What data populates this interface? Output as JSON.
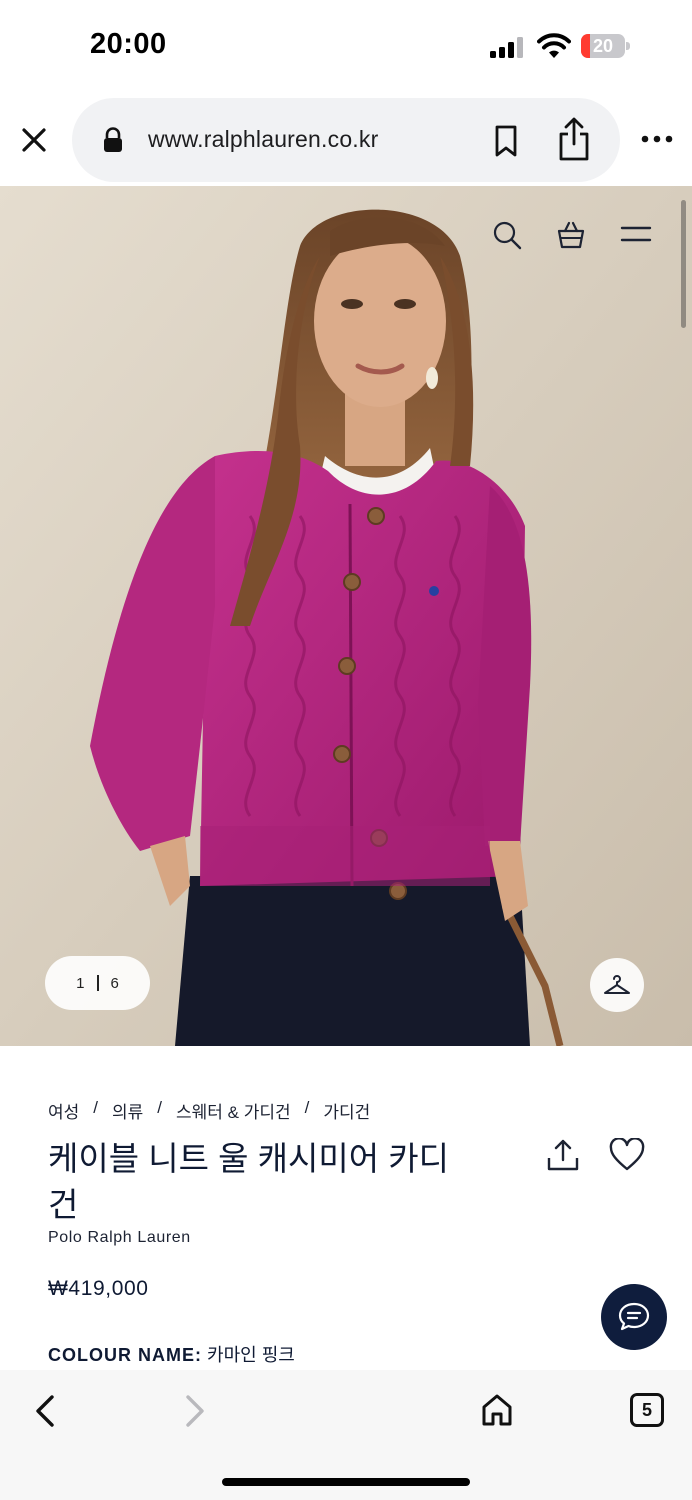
{
  "status_bar": {
    "time": "20:00",
    "battery_level": "20",
    "battery_fraction": 0.2,
    "battery_color": "#ff3b30"
  },
  "browser": {
    "url": "www.ralphlauren.co.kr",
    "icons": [
      "close-icon",
      "lock-icon",
      "bookmark-icon",
      "share-icon",
      "more-icon"
    ]
  },
  "hero": {
    "image_index": "1",
    "image_total": "6",
    "icons": [
      "search-icon",
      "bag-icon",
      "menu-icon",
      "hanger-icon"
    ],
    "sweater_color": "#b5237e"
  },
  "product": {
    "breadcrumb": [
      {
        "label": "여성",
        "sep": "/"
      },
      {
        "label": "의류",
        "sep": "/"
      },
      {
        "label": "스웨터 & 가디건",
        "sep": "/"
      },
      {
        "label": "가디건",
        "sep": ""
      }
    ],
    "title": "케이블 니트 울 캐시미어 카디건",
    "brand": "Polo Ralph Lauren",
    "price": "₩419,000",
    "colour_label": "COLOUR NAME:",
    "colour_value": "카마인 핑크"
  },
  "toolbar": {
    "tab_count": "5",
    "icons": [
      "back-icon",
      "forward-icon",
      "home-icon",
      "tabs-icon"
    ]
  },
  "colors": {
    "navy": "#0f1d3d",
    "text": "#0f1a33"
  }
}
